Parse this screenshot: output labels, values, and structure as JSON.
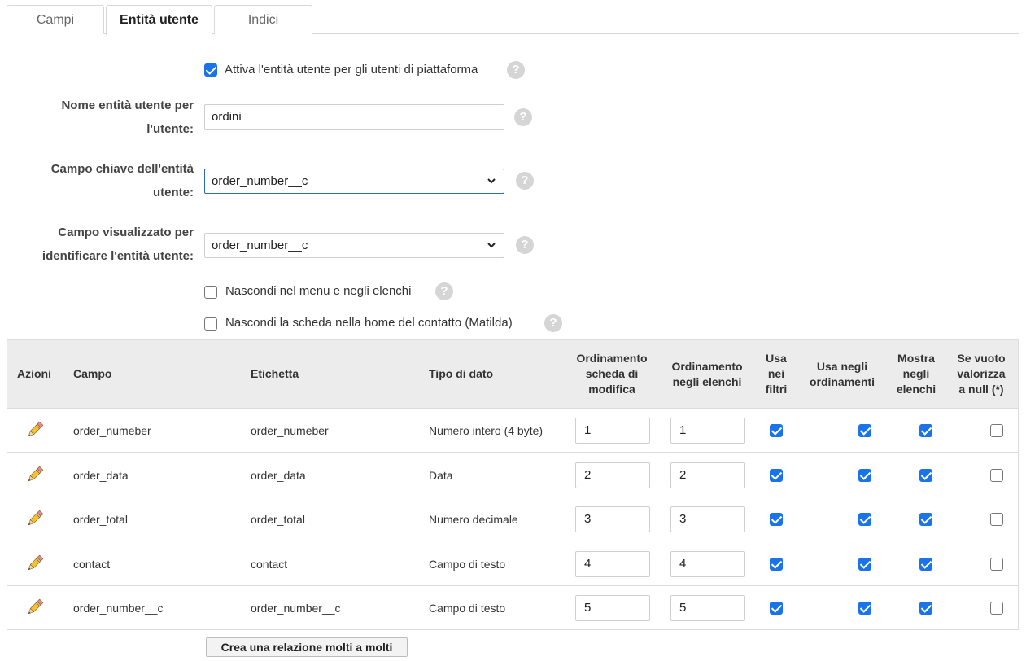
{
  "tabs": [
    {
      "label": "Campi",
      "active": false
    },
    {
      "label": "Entità utente",
      "active": true
    },
    {
      "label": "Indici",
      "active": false
    }
  ],
  "form": {
    "enable_checkbox": {
      "label": "Attiva l'entità utente per gli utenti di piattaforma",
      "checked": true
    },
    "name_label_line1": "Nome entità utente per",
    "name_label_line2": "l'utente:",
    "name_value": "ordini",
    "key_label_line1": "Campo chiave dell'entità",
    "key_label_line2": "utente:",
    "key_value": "order_number__c",
    "display_label_line1": "Campo visualizzato per",
    "display_label_line2": "identificare l'entità utente:",
    "display_value": "order_number__c",
    "hide_menu": {
      "label": "Nascondi nel menu e negli elenchi",
      "checked": false
    },
    "hide_tab": {
      "label": "Nascondi la scheda nella home del contatto (Matilda)",
      "checked": false
    },
    "help_glyph": "?"
  },
  "table": {
    "headers": {
      "azioni": "Azioni",
      "campo": "Campo",
      "etichetta": "Etichetta",
      "tipo": "Tipo di dato",
      "ord_scheda": [
        "Ordinamento",
        "scheda di",
        "modifica"
      ],
      "ord_elenchi": [
        "Ordinamento",
        "negli elenchi"
      ],
      "usa_filtri": [
        "Usa",
        "nei",
        "filtri"
      ],
      "usa_ord": [
        "Usa negli",
        "ordinamenti"
      ],
      "mostra": [
        "Mostra",
        "negli",
        "elenchi"
      ],
      "null": [
        "Se vuoto",
        "valorizza",
        "a null (*)"
      ]
    },
    "rows": [
      {
        "campo": "order_numeber",
        "etichetta": "order_numeber",
        "tipo": "Numero intero (4 byte)",
        "ord_scheda": "1",
        "ord_elenchi": "1",
        "filtri": true,
        "ordinamenti": true,
        "mostra": true,
        "null": false
      },
      {
        "campo": "order_data",
        "etichetta": "order_data",
        "tipo": "Data",
        "ord_scheda": "2",
        "ord_elenchi": "2",
        "filtri": true,
        "ordinamenti": true,
        "mostra": true,
        "null": false
      },
      {
        "campo": "order_total",
        "etichetta": "order_total",
        "tipo": "Numero decimale",
        "ord_scheda": "3",
        "ord_elenchi": "3",
        "filtri": true,
        "ordinamenti": true,
        "mostra": true,
        "null": false
      },
      {
        "campo": "contact",
        "etichetta": "contact",
        "tipo": "Campo di testo",
        "ord_scheda": "4",
        "ord_elenchi": "4",
        "filtri": true,
        "ordinamenti": true,
        "mostra": true,
        "null": false
      },
      {
        "campo": "order_number__c",
        "etichetta": "order_number__c",
        "tipo": "Campo di testo",
        "ord_scheda": "5",
        "ord_elenchi": "5",
        "filtri": true,
        "ordinamenti": true,
        "mostra": true,
        "null": false
      }
    ],
    "edit_icon": "pencil-icon"
  },
  "create_button": "Crea una relazione molti a molti",
  "colors": {
    "accent": "#1a73e8",
    "header_bg": "#ececec",
    "border": "#dcdcdc"
  }
}
